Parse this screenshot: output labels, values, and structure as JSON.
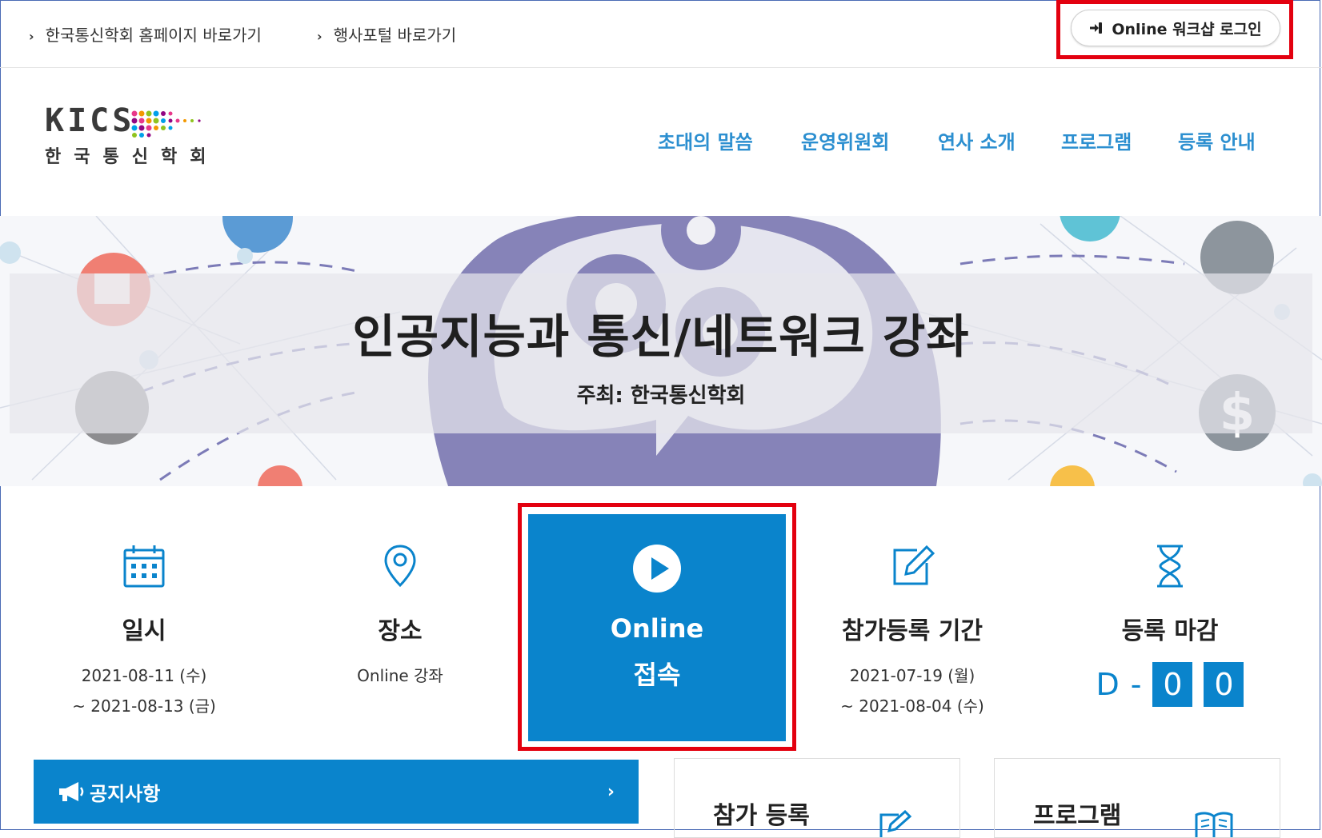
{
  "topbar": {
    "link1": "한국통신학회 홈페이지 바로가기",
    "link2": "행사포털 바로가기",
    "login_label": "Online 워크샵 로그인"
  },
  "logo": {
    "en": "KICS",
    "ko": "한국통신학회"
  },
  "nav": [
    "초대의 말씀",
    "운영위원회",
    "연사 소개",
    "프로그램",
    "등록 안내"
  ],
  "banner": {
    "title": "인공지능과 통신/네트워크 강좌",
    "subtitle": "주최: 한국통신학회"
  },
  "info": {
    "date": {
      "label": "일시",
      "line1": "2021-08-11 (수)",
      "line2": "~ 2021-08-13 (금)",
      "icon": "calendar-icon"
    },
    "place": {
      "label": "장소",
      "value": "Online 강좌",
      "icon": "map-pin-icon"
    },
    "online": {
      "line1": "Online",
      "line2": "접속",
      "icon": "play-icon"
    },
    "registration": {
      "label": "참가등록 기간",
      "line1": "2021-07-19 (월)",
      "line2": "~ 2021-08-04 (수)",
      "icon": "edit-icon"
    },
    "deadline": {
      "label": "등록 마감",
      "prefix": "D",
      "dash": "-",
      "digit1": "0",
      "digit2": "0",
      "icon": "hourglass-icon"
    }
  },
  "bottom": {
    "notice_label": "공지사항",
    "notice_arrow": "›",
    "card1": "참가 등록",
    "card2": "프로그램"
  },
  "colors": {
    "accent": "#0a84cc",
    "nav": "#2c8fd0",
    "highlight": "#e3000f"
  }
}
